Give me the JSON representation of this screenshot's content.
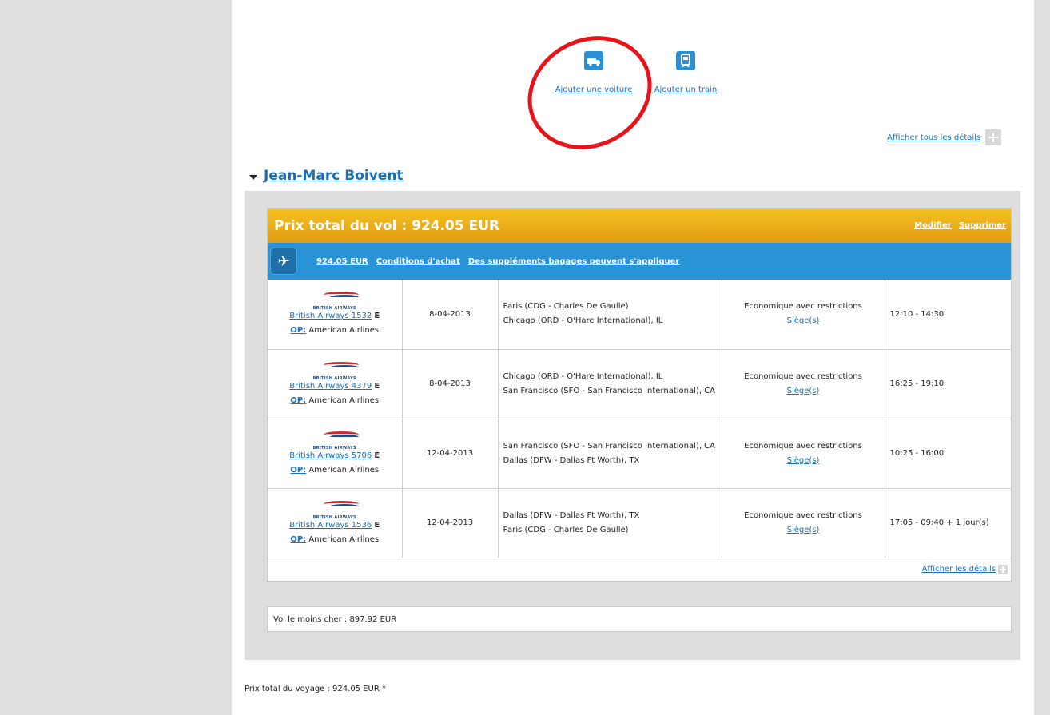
{
  "add": {
    "car_label": "Ajouter une voiture",
    "train_label": "Ajouter un train"
  },
  "details": {
    "show_all": "Afficher tous les détails",
    "show": "Afficher les détails"
  },
  "traveler": {
    "name": "Jean-Marc Boivent"
  },
  "flight": {
    "header_title": "Prix total du vol : 924.05 EUR",
    "modify": "Modifier",
    "delete": "Supprimer",
    "price_link": "924.05 EUR",
    "conditions": "Conditions d'achat",
    "baggage": "Des suppléments bagages peuvent s'appliquer",
    "airline_logo_text": "BRITISH AIRWAYS",
    "segments": [
      {
        "flight": "British Airways 1532",
        "fare_class": "E",
        "op_label": "OP:",
        "operator": "American Airlines",
        "date": "8-04-2013",
        "route_from": "Paris (CDG - Charles De Gaulle)",
        "route_to": "Chicago (ORD - O'Hare International), IL",
        "cabin": "Economique avec restrictions",
        "seat": "Siège(s)",
        "time": "12:10 - 14:30"
      },
      {
        "flight": "British Airways 4379",
        "fare_class": "E",
        "op_label": "OP:",
        "operator": "American Airlines",
        "date": "8-04-2013",
        "route_from": "Chicago (ORD - O'Hare International), IL",
        "route_to": "San Francisco (SFO - San Francisco International), CA",
        "cabin": "Economique avec restrictions",
        "seat": "Siège(s)",
        "time": "16:25 - 19:10"
      },
      {
        "flight": "British Airways 5706",
        "fare_class": "E",
        "op_label": "OP:",
        "operator": "American Airlines",
        "date": "12-04-2013",
        "route_from": "San Francisco (SFO - San Francisco International), CA",
        "route_to": "Dallas (DFW - Dallas Ft Worth), TX",
        "cabin": "Economique avec restrictions",
        "seat": "Siège(s)",
        "time": "10:25 - 16:00"
      },
      {
        "flight": "British Airways 1536",
        "fare_class": "E",
        "op_label": "OP:",
        "operator": "American Airlines",
        "date": "12-04-2013",
        "route_from": "Dallas (DFW - Dallas Ft Worth), TX",
        "route_to": "Paris (CDG - Charles De Gaulle)",
        "cabin": "Economique avec restrictions",
        "seat": "Siège(s)",
        "time": "17:05 - 09:40 + 1 jour(s)"
      }
    ]
  },
  "cheapest": "Vol le moins cher : 897.92 EUR",
  "total_trip": "Prix total du voyage : 924.05 EUR *",
  "colors": {
    "link": "#1a6fb5",
    "header_orange": "#f0b01c",
    "blue_bar": "#2a93d5",
    "annotation_circle": "#e8141b"
  }
}
